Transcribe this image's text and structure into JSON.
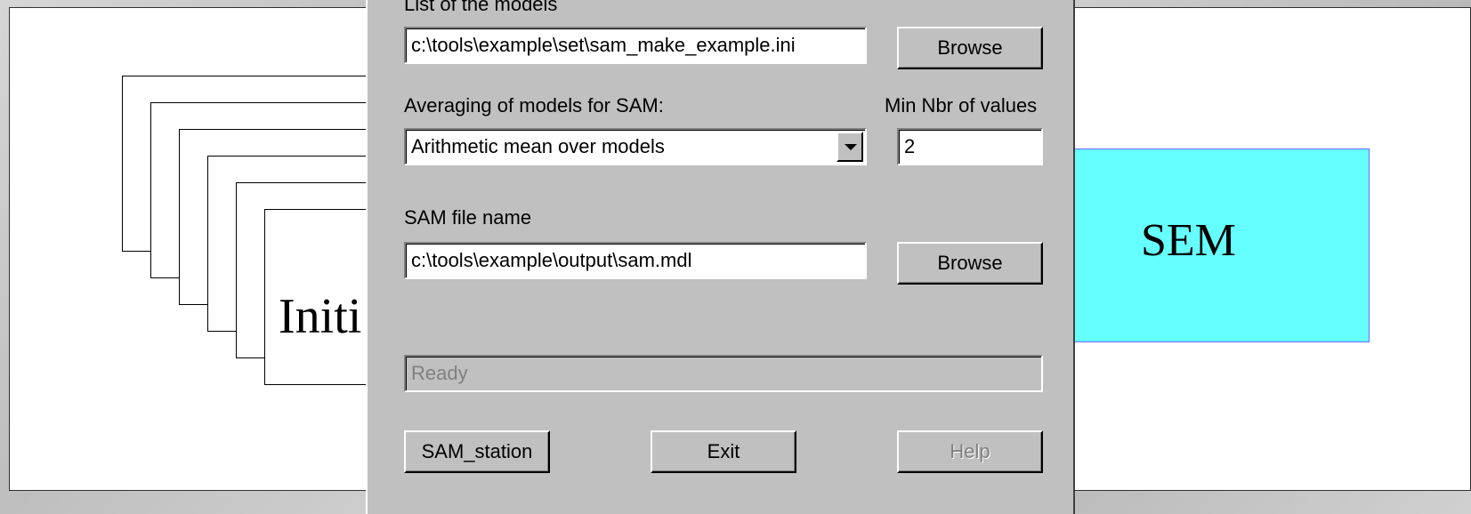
{
  "slide": {
    "stack_label": "Initi",
    "sem_label": "SEM"
  },
  "dialog": {
    "models_list_label": "List of the models",
    "models_list_value": "c:\\tools\\example\\set\\sam_make_example.ini",
    "browse_label": "Browse",
    "averaging_label": "Averaging of models for SAM:",
    "averaging_selected": "Arithmetic mean over models",
    "min_values_label": "Min Nbr of values",
    "min_values_value": "2",
    "sam_file_label": "SAM file name",
    "sam_file_value": "c:\\tools\\example\\output\\sam.mdl",
    "status_text": "Ready",
    "sam_station_label": "SAM_station",
    "exit_label": "Exit",
    "help_label": "Help"
  },
  "colors": {
    "dialog_bg": "#c0c0c0",
    "sem_box_fill": "#66ffff",
    "sem_box_border": "#6a6aff"
  }
}
